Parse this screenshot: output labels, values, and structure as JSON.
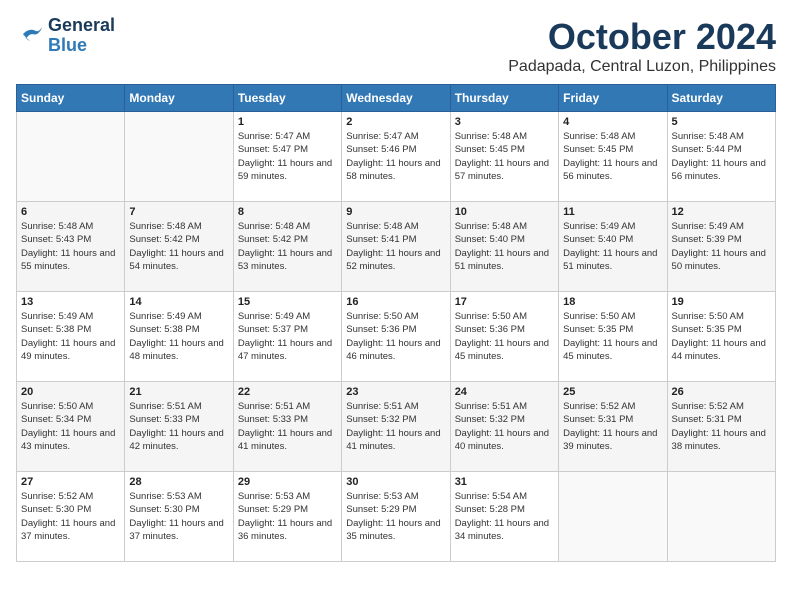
{
  "logo": {
    "line1": "General",
    "line2": "Blue"
  },
  "title": "October 2024",
  "subtitle": "Padapada, Central Luzon, Philippines",
  "weekdays": [
    "Sunday",
    "Monday",
    "Tuesday",
    "Wednesday",
    "Thursday",
    "Friday",
    "Saturday"
  ],
  "weeks": [
    [
      {
        "day": "",
        "info": ""
      },
      {
        "day": "",
        "info": ""
      },
      {
        "day": "1",
        "info": "Sunrise: 5:47 AM\nSunset: 5:47 PM\nDaylight: 11 hours and 59 minutes."
      },
      {
        "day": "2",
        "info": "Sunrise: 5:47 AM\nSunset: 5:46 PM\nDaylight: 11 hours and 58 minutes."
      },
      {
        "day": "3",
        "info": "Sunrise: 5:48 AM\nSunset: 5:45 PM\nDaylight: 11 hours and 57 minutes."
      },
      {
        "day": "4",
        "info": "Sunrise: 5:48 AM\nSunset: 5:45 PM\nDaylight: 11 hours and 56 minutes."
      },
      {
        "day": "5",
        "info": "Sunrise: 5:48 AM\nSunset: 5:44 PM\nDaylight: 11 hours and 56 minutes."
      }
    ],
    [
      {
        "day": "6",
        "info": "Sunrise: 5:48 AM\nSunset: 5:43 PM\nDaylight: 11 hours and 55 minutes."
      },
      {
        "day": "7",
        "info": "Sunrise: 5:48 AM\nSunset: 5:42 PM\nDaylight: 11 hours and 54 minutes."
      },
      {
        "day": "8",
        "info": "Sunrise: 5:48 AM\nSunset: 5:42 PM\nDaylight: 11 hours and 53 minutes."
      },
      {
        "day": "9",
        "info": "Sunrise: 5:48 AM\nSunset: 5:41 PM\nDaylight: 11 hours and 52 minutes."
      },
      {
        "day": "10",
        "info": "Sunrise: 5:48 AM\nSunset: 5:40 PM\nDaylight: 11 hours and 51 minutes."
      },
      {
        "day": "11",
        "info": "Sunrise: 5:49 AM\nSunset: 5:40 PM\nDaylight: 11 hours and 51 minutes."
      },
      {
        "day": "12",
        "info": "Sunrise: 5:49 AM\nSunset: 5:39 PM\nDaylight: 11 hours and 50 minutes."
      }
    ],
    [
      {
        "day": "13",
        "info": "Sunrise: 5:49 AM\nSunset: 5:38 PM\nDaylight: 11 hours and 49 minutes."
      },
      {
        "day": "14",
        "info": "Sunrise: 5:49 AM\nSunset: 5:38 PM\nDaylight: 11 hours and 48 minutes."
      },
      {
        "day": "15",
        "info": "Sunrise: 5:49 AM\nSunset: 5:37 PM\nDaylight: 11 hours and 47 minutes."
      },
      {
        "day": "16",
        "info": "Sunrise: 5:50 AM\nSunset: 5:36 PM\nDaylight: 11 hours and 46 minutes."
      },
      {
        "day": "17",
        "info": "Sunrise: 5:50 AM\nSunset: 5:36 PM\nDaylight: 11 hours and 45 minutes."
      },
      {
        "day": "18",
        "info": "Sunrise: 5:50 AM\nSunset: 5:35 PM\nDaylight: 11 hours and 45 minutes."
      },
      {
        "day": "19",
        "info": "Sunrise: 5:50 AM\nSunset: 5:35 PM\nDaylight: 11 hours and 44 minutes."
      }
    ],
    [
      {
        "day": "20",
        "info": "Sunrise: 5:50 AM\nSunset: 5:34 PM\nDaylight: 11 hours and 43 minutes."
      },
      {
        "day": "21",
        "info": "Sunrise: 5:51 AM\nSunset: 5:33 PM\nDaylight: 11 hours and 42 minutes."
      },
      {
        "day": "22",
        "info": "Sunrise: 5:51 AM\nSunset: 5:33 PM\nDaylight: 11 hours and 41 minutes."
      },
      {
        "day": "23",
        "info": "Sunrise: 5:51 AM\nSunset: 5:32 PM\nDaylight: 11 hours and 41 minutes."
      },
      {
        "day": "24",
        "info": "Sunrise: 5:51 AM\nSunset: 5:32 PM\nDaylight: 11 hours and 40 minutes."
      },
      {
        "day": "25",
        "info": "Sunrise: 5:52 AM\nSunset: 5:31 PM\nDaylight: 11 hours and 39 minutes."
      },
      {
        "day": "26",
        "info": "Sunrise: 5:52 AM\nSunset: 5:31 PM\nDaylight: 11 hours and 38 minutes."
      }
    ],
    [
      {
        "day": "27",
        "info": "Sunrise: 5:52 AM\nSunset: 5:30 PM\nDaylight: 11 hours and 37 minutes."
      },
      {
        "day": "28",
        "info": "Sunrise: 5:53 AM\nSunset: 5:30 PM\nDaylight: 11 hours and 37 minutes."
      },
      {
        "day": "29",
        "info": "Sunrise: 5:53 AM\nSunset: 5:29 PM\nDaylight: 11 hours and 36 minutes."
      },
      {
        "day": "30",
        "info": "Sunrise: 5:53 AM\nSunset: 5:29 PM\nDaylight: 11 hours and 35 minutes."
      },
      {
        "day": "31",
        "info": "Sunrise: 5:54 AM\nSunset: 5:28 PM\nDaylight: 11 hours and 34 minutes."
      },
      {
        "day": "",
        "info": ""
      },
      {
        "day": "",
        "info": ""
      }
    ]
  ]
}
